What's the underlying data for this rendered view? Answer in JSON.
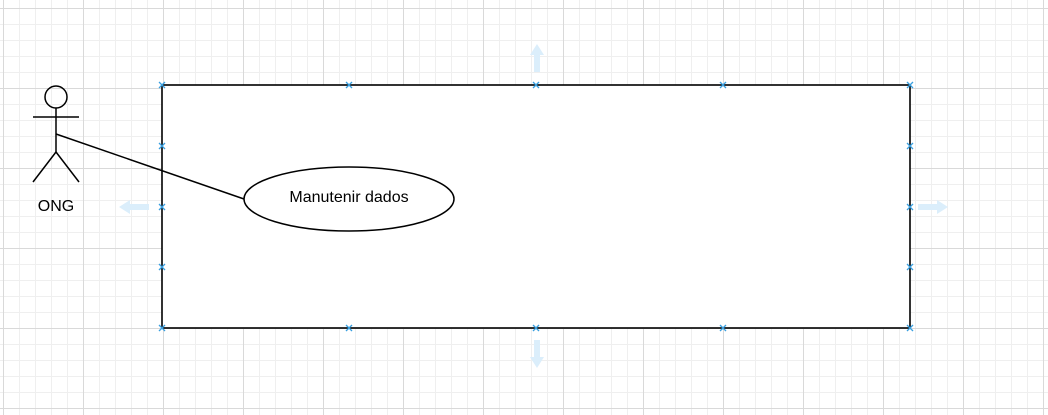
{
  "diagram": {
    "type": "use-case",
    "actor": {
      "name": "ONG"
    },
    "use_cases": [
      {
        "label": "Manutenir dados"
      }
    ],
    "colors": {
      "stroke": "#000000",
      "selection_handle": "#3aa0e0",
      "resize_arrow": "#dbeefb",
      "grid_major": "#d9d9d9",
      "grid_minor": "#efefef"
    }
  }
}
